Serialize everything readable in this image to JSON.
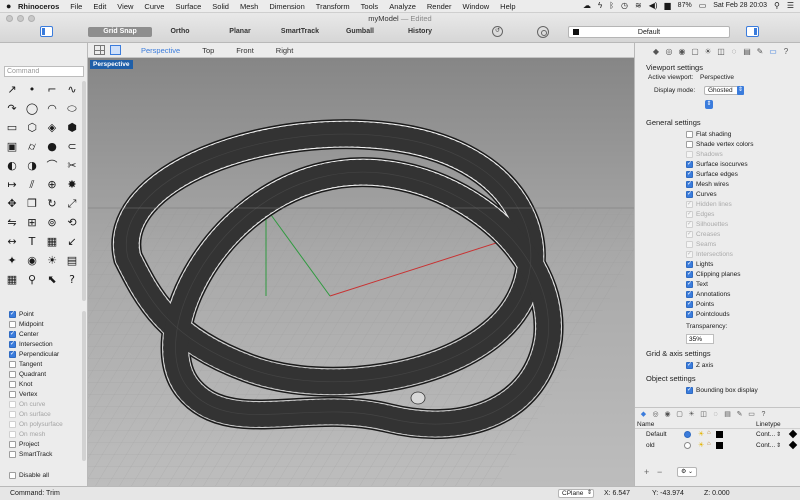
{
  "menubar": {
    "apple": "",
    "app": "Rhinoceros",
    "items": [
      "File",
      "Edit",
      "View",
      "Curve",
      "Surface",
      "Solid",
      "Mesh",
      "Dimension",
      "Transform",
      "Tools",
      "Analyze",
      "Render",
      "Window",
      "Help"
    ],
    "battery": "87%",
    "datetime": "Sat Feb 28  20:03"
  },
  "window": {
    "title": "myModel",
    "edited": "— Edited"
  },
  "toolbar": {
    "grid_snap": "Grid Snap",
    "ortho": "Ortho",
    "planar": "Planar",
    "smarttrack": "SmartTrack",
    "gumball": "Gumball",
    "history": "History",
    "current_layer": "Default"
  },
  "command": {
    "placeholder": "Command"
  },
  "tools": [
    "curve-tools-a",
    "point",
    "polyline",
    "curve-cv",
    "interp-curve",
    "circle",
    "arc",
    "ellipse",
    "rectangle",
    "polygon",
    "surface-a",
    "surface-b",
    "solid-box",
    "cylinder",
    "sphere",
    "pipe",
    "boolean-a",
    "boolean-b",
    "fillet",
    "trim",
    "extend",
    "split",
    "join",
    "explode",
    "move",
    "copy",
    "rotate",
    "scale",
    "mirror",
    "array",
    "offset",
    "rebuild",
    "dimension",
    "text",
    "hatch",
    "leader",
    "lights",
    "camera",
    "render",
    "layer",
    "grid",
    "analyze",
    "select",
    "help"
  ],
  "tool_glyphs": [
    "↗",
    "•",
    "⌐",
    "∿",
    "↷",
    "◯",
    "◠",
    "⬭",
    "▭",
    "⬡",
    "◈",
    "⬢",
    "▣",
    "⌭",
    "●",
    "⊂",
    "◐",
    "◑",
    "⌒",
    "✂",
    "↦",
    "⫽",
    "⊕",
    "✸",
    "✥",
    "❐",
    "↻",
    "⤢",
    "⇋",
    "⊞",
    "⊚",
    "⟲",
    "↔",
    "T",
    "▦",
    "↙",
    "✦",
    "◉",
    "☀",
    "▤",
    "▦",
    "⚲",
    "⬉",
    "?"
  ],
  "osnaps": [
    {
      "label": "Point",
      "state": "on"
    },
    {
      "label": "Midpoint",
      "state": "off"
    },
    {
      "label": "Center",
      "state": "on"
    },
    {
      "label": "Intersection",
      "state": "on"
    },
    {
      "label": "Perpendicular",
      "state": "on"
    },
    {
      "label": "Tangent",
      "state": "off"
    },
    {
      "label": "Quadrant",
      "state": "off"
    },
    {
      "label": "Knot",
      "state": "off"
    },
    {
      "label": "Vertex",
      "state": "off"
    },
    {
      "label": "On curve",
      "state": "dis"
    },
    {
      "label": "On surface",
      "state": "dis"
    },
    {
      "label": "On polysurface",
      "state": "dis"
    },
    {
      "label": "On mesh",
      "state": "dis"
    },
    {
      "label": "Project",
      "state": "off"
    },
    {
      "label": "SmartTrack",
      "state": "off"
    }
  ],
  "disable_all": "Disable all",
  "view_tabs": [
    "Perspective",
    "Top",
    "Front",
    "Right"
  ],
  "viewport": {
    "label": "Perspective"
  },
  "right_panel": {
    "viewport_settings": "Viewport settings",
    "active_viewport_label": "Active viewport:",
    "active_viewport_value": "Perspective",
    "display_mode_label": "Display mode:",
    "display_mode_value": "Ghosted",
    "general_settings": "General settings",
    "general_items": [
      {
        "label": "Flat shading",
        "state": "off"
      },
      {
        "label": "Shade vertex colors",
        "state": "off"
      },
      {
        "label": "Shadows",
        "state": "dis"
      },
      {
        "label": "Surface isocurves",
        "state": "on"
      },
      {
        "label": "Surface edges",
        "state": "on"
      },
      {
        "label": "Mesh wires",
        "state": "on"
      },
      {
        "label": "Curves",
        "state": "on"
      },
      {
        "label": "Hidden lines",
        "state": "dison"
      },
      {
        "label": "Edges",
        "state": "dison"
      },
      {
        "label": "Silhouettes",
        "state": "dison"
      },
      {
        "label": "Creases",
        "state": "dison"
      },
      {
        "label": "Seams",
        "state": "dis"
      },
      {
        "label": "Intersections",
        "state": "dison"
      },
      {
        "label": "Lights",
        "state": "on"
      },
      {
        "label": "Clipping planes",
        "state": "on"
      },
      {
        "label": "Text",
        "state": "on"
      },
      {
        "label": "Annotations",
        "state": "on"
      },
      {
        "label": "Points",
        "state": "on"
      },
      {
        "label": "Pointclouds",
        "state": "on"
      }
    ],
    "transparency_label": "Transparency:",
    "transparency_value": "35%",
    "grid_axis_settings": "Grid & axis settings",
    "z_axis_label": "Z axis",
    "object_settings": "Object settings",
    "bounding_box_label": "Bounding box display"
  },
  "layers": {
    "col_name": "Name",
    "col_linetype": "Linetype",
    "rows": [
      {
        "name": "Default",
        "current": true,
        "linetype": "Cont..."
      },
      {
        "name": "old",
        "current": false,
        "linetype": "Cont..."
      }
    ],
    "add": "+",
    "remove": "−",
    "gear": "⚙ ⌄"
  },
  "status": {
    "command": "Command: Trim",
    "cplane": "CPlane",
    "x": "X: 6.547",
    "y": "Y: -43.974",
    "z": "Z: 0.000"
  },
  "colors": {
    "accent": "#3b7cdc",
    "viewport_label": "#1f5fa8",
    "axis_x": "#c83232",
    "axis_y": "#2f9a3f"
  }
}
